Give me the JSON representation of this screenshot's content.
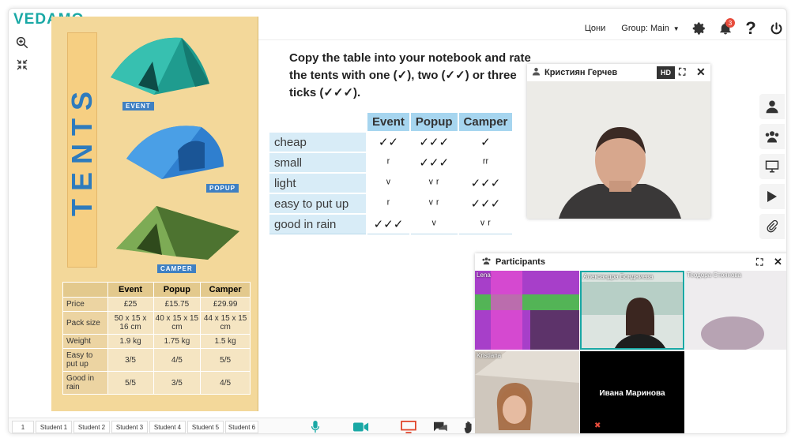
{
  "app": {
    "logo": "VEDAMO"
  },
  "topbar": {
    "prices": "Цони",
    "group": "Group: Main",
    "notification_count": "3"
  },
  "book": {
    "title": "TENTS",
    "tent_labels": [
      "EVENT",
      "POPUP",
      "CAMPER"
    ],
    "specs": {
      "headers": [
        "",
        "Event",
        "Popup",
        "Camper"
      ],
      "rows": [
        [
          "Price",
          "£25",
          "£15.75",
          "£29.99"
        ],
        [
          "Pack size",
          "50 x 15 x 16 cm",
          "40 x 15 x 15 cm",
          "44 x 15 x 15 cm"
        ],
        [
          "Weight",
          "1.9 kg",
          "1.75 kg",
          "1.5 kg"
        ],
        [
          "Easy to put up",
          "3/5",
          "4/5",
          "5/5"
        ],
        [
          "Good in rain",
          "5/5",
          "3/5",
          "4/5"
        ]
      ]
    }
  },
  "exercise": {
    "instruction": "Copy the table into your notebook and rate the tents with one (✓), two (✓✓) or three ticks (✓✓✓).",
    "headers": [
      "",
      "Event",
      "Popup",
      "Camper"
    ],
    "rows": [
      [
        "cheap",
        "✓✓",
        "✓✓✓",
        "✓"
      ],
      [
        "small",
        "ʳ",
        "✓✓✓",
        "ʳʳ"
      ],
      [
        "light",
        "ᵛ",
        "ᵛ ʳ",
        "✓✓✓"
      ],
      [
        "easy to put up",
        "ʳ",
        "ᵛ ʳ",
        "✓✓✓"
      ],
      [
        "good in rain",
        "✓✓✓",
        "ᵛ",
        "ᵛ ʳ"
      ]
    ]
  },
  "video": {
    "name": "Кристиян Герчев",
    "hd": "HD"
  },
  "participants": {
    "title": "Participants",
    "tiles": [
      {
        "name": "Lena",
        "color": "#cc33cc"
      },
      {
        "name": "Александра Бояджиева",
        "color": "#cfd9d4"
      },
      {
        "name": "Теодора Стоянова",
        "color": "#e8e6ea"
      },
      {
        "name": "Kristiana",
        "color": "#b5a99a"
      },
      {
        "name": "Ивана Маринова",
        "color": "#000000"
      }
    ]
  },
  "bottombar": {
    "page": "1",
    "students": [
      "Student 1",
      "Student 2",
      "Student 3",
      "Student 4",
      "Student 5",
      "Student 6"
    ]
  },
  "colors": {
    "brand": "#19a8a5",
    "notification": "#e74c3c",
    "table_header": "#a6d5ef"
  }
}
